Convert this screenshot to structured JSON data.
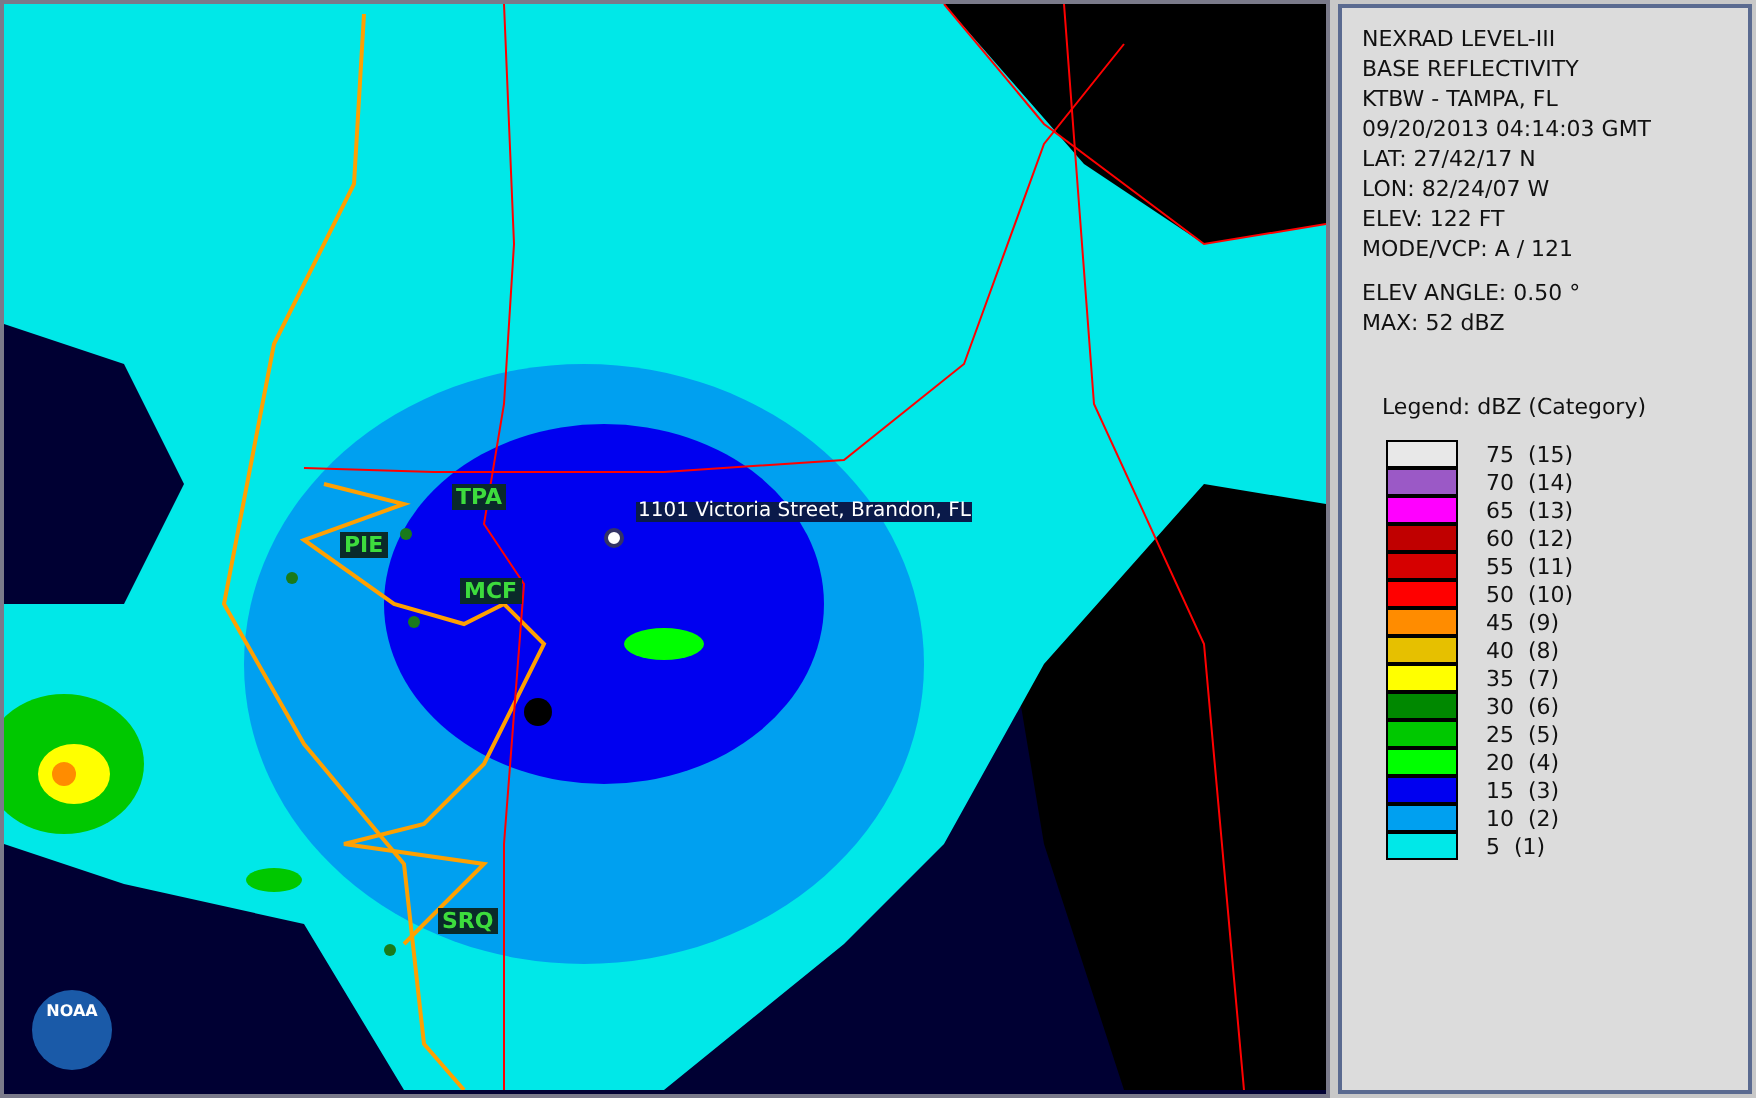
{
  "map": {
    "stations": [
      {
        "code": "TPA",
        "color": "#1a7a1a"
      },
      {
        "code": "PIE",
        "color": "#1a7a1a"
      },
      {
        "code": "MCF",
        "color": "#1a7a1a"
      },
      {
        "code": "SRQ",
        "color": "#1a7a1a"
      }
    ],
    "address_marker": {
      "label": "1101 Victoria Street, Brandon, FL"
    },
    "logo": {
      "text": "NOAA"
    }
  },
  "info": {
    "lines": [
      "NEXRAD LEVEL-III",
      "BASE REFLECTIVITY",
      "KTBW - TAMPA, FL",
      "09/20/2013 04:14:03 GMT",
      "LAT: 27/42/17 N",
      "LON: 82/24/07 W",
      "ELEV: 122 FT",
      "MODE/VCP: A / 121"
    ],
    "extra_lines": [
      "ELEV ANGLE: 0.50 °",
      "MAX: 52 dBZ"
    ]
  },
  "legend": {
    "title": "Legend: dBZ (Category)",
    "items": [
      {
        "value": "75",
        "category": "(15)",
        "color": "#e8e8e8"
      },
      {
        "value": "70",
        "category": "(14)",
        "color": "#9b59c6"
      },
      {
        "value": "65",
        "category": "(13)",
        "color": "#ff00ff"
      },
      {
        "value": "60",
        "category": "(12)",
        "color": "#c00000"
      },
      {
        "value": "55",
        "category": "(11)",
        "color": "#d60000"
      },
      {
        "value": "50",
        "category": "(10)",
        "color": "#ff0000"
      },
      {
        "value": "45",
        "category": "(9)",
        "color": "#ff8c00"
      },
      {
        "value": "40",
        "category": "(8)",
        "color": "#e6c000"
      },
      {
        "value": "35",
        "category": "(7)",
        "color": "#ffff00"
      },
      {
        "value": "30",
        "category": "(6)",
        "color": "#008800"
      },
      {
        "value": "25",
        "category": "(5)",
        "color": "#00c800"
      },
      {
        "value": "20",
        "category": "(4)",
        "color": "#00ff00"
      },
      {
        "value": "15",
        "category": "(3)",
        "color": "#0000f0"
      },
      {
        "value": "10",
        "category": "(2)",
        "color": "#00a0f0"
      },
      {
        "value": "5",
        "category": "(1)",
        "color": "#00e8e8"
      }
    ]
  }
}
